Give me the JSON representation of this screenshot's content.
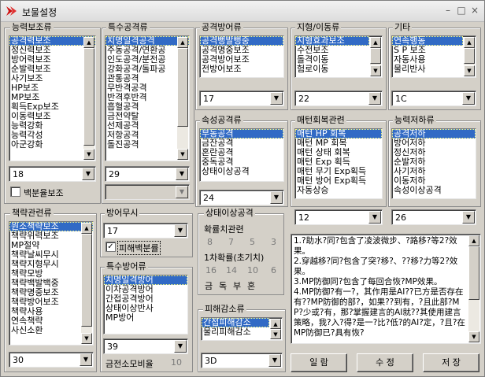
{
  "window": {
    "title": "보물설정",
    "minimize_glyph": "–",
    "maximize_glyph": "□",
    "close_glyph": "×",
    "icon": "red-arrow-app-icon"
  },
  "groups": {
    "ability_support": {
      "title": "능력보조류",
      "items": [
        "공격력보조",
        "정신력보조",
        "방어력보조",
        "순발력보조",
        "사기보조",
        "HP보조",
        "MP보조",
        "획득Exp보조",
        "이동력보조",
        "능력강화",
        "능력각성",
        "아군강화"
      ],
      "selected_index": 0,
      "combo_value": "18",
      "checkbox_label": "백분율보조",
      "checkbox_checked": false
    },
    "special_attack": {
      "title": "특수공격류",
      "items": [
        "치명일격공격",
        "주동공격/연환공",
        "인도공격/분전공",
        "강화공격/돌파공",
        "관통공격",
        "무반격공격",
        "반격후반격",
        "흡혈공격",
        "금전약탈",
        "선제공격",
        "저항공격",
        "돌진공격"
      ],
      "selected_index": 0,
      "combo_value": "29",
      "combo2_value": ""
    },
    "attack_defense": {
      "title": "공격방어류",
      "items": [
        "공격뻥발뻥중",
        "공격명중보조",
        "공격방어보조",
        "전방어보조"
      ],
      "selected_index": 0,
      "combo_value": "17"
    },
    "terrain_move": {
      "title": "지형/이동류",
      "items": [
        "지형효과보조",
        "수전보조",
        "돌격이동",
        "험로이동"
      ],
      "selected_index": 0,
      "combo_value": "22"
    },
    "misc": {
      "title": "기타",
      "items": [
        "연속행동",
        "S P 보조",
        "자동사용",
        "물리반사"
      ],
      "selected_index": 0,
      "combo_value": "1C"
    },
    "attribute_attack": {
      "title": "속성공격류",
      "items": [
        "부동공격",
        "금잔공격",
        "혼란공격",
        "중독공격",
        "상태이상공격"
      ],
      "selected_index": 0,
      "combo_value": "24"
    },
    "turn_recovery": {
      "title": "매턴회복관련",
      "items": [
        "매턴 HP 회복",
        "매턴 MP 회복",
        "매턴 상태 회복",
        "매턴 Exp 획득",
        "매턴 무기 Exp획득",
        "매턴 방어 Exp획득",
        "자동상승"
      ],
      "selected_index": 0,
      "combo_value": "12"
    },
    "ability_decrease": {
      "title": "능력저하류",
      "items": [
        "공격저하",
        "방어저하",
        "정신저하",
        "순발저하",
        "사기저하",
        "이동저하",
        "속성이상공격"
      ],
      "selected_index": 0,
      "combo_value": "26"
    },
    "strategy": {
      "title": "책략관련류",
      "items": [
        "원소책략보조",
        "책략위력보조",
        "MP절약",
        "책략날씨무시",
        "책략지형무시",
        "책략모방",
        "책략백발백중",
        "책략명중보조",
        "책략방어보조",
        "책략사용",
        "연속책략",
        "사신소환"
      ],
      "selected_index": 0,
      "combo_value": "30"
    },
    "ignore_defense": {
      "title": "방어무시",
      "combo_value": "17",
      "checkbox_label": "피해백분률",
      "checkbox_checked": true
    },
    "special_defense": {
      "title": "특수방어류",
      "items": [
        "치명일격방어",
        "이차공격방어",
        "간접공격방어",
        "상태이상반사",
        "MP방어"
      ],
      "selected_index": 0,
      "combo_value": "39",
      "cost_label": "금전소모비율",
      "cost_value": "10"
    },
    "status_attack": {
      "title": "상태이상공격",
      "prob_label": "확률치관련",
      "row1": [
        "8",
        "7",
        "5",
        "3"
      ],
      "first_prob_label": "1차확률(초기치)",
      "row2": [
        "16",
        "14",
        "10",
        "6"
      ],
      "row3": [
        "금",
        "독",
        "부",
        "혼"
      ]
    },
    "damage_reduction": {
      "title": "피해감소류",
      "items": [
        "간접피해감소",
        "물리피해감소"
      ],
      "selected_index": 0,
      "combo_value": "3D"
    }
  },
  "info_text": "1.?助水?同?包含了凌波微步、?路移?等2?效果。\n2.穿越移?同?包含了突?移?、??移?力等2?效果。\n3.MP防御同?包含了每回合恢?MP效果。\n4.MP防御?有一?，其作用是AI??已方是否存在有??MP防御的部?，如果??到有，?且此部?MP?少或?有，那?掌握建言的AI就??其使用建言策略，我?入?得?是一?比?低?的AI?定，?且?在MP防御已?具有恢?",
  "buttons": {
    "read": "일 람",
    "edit": "수 정",
    "save": "저 장"
  }
}
